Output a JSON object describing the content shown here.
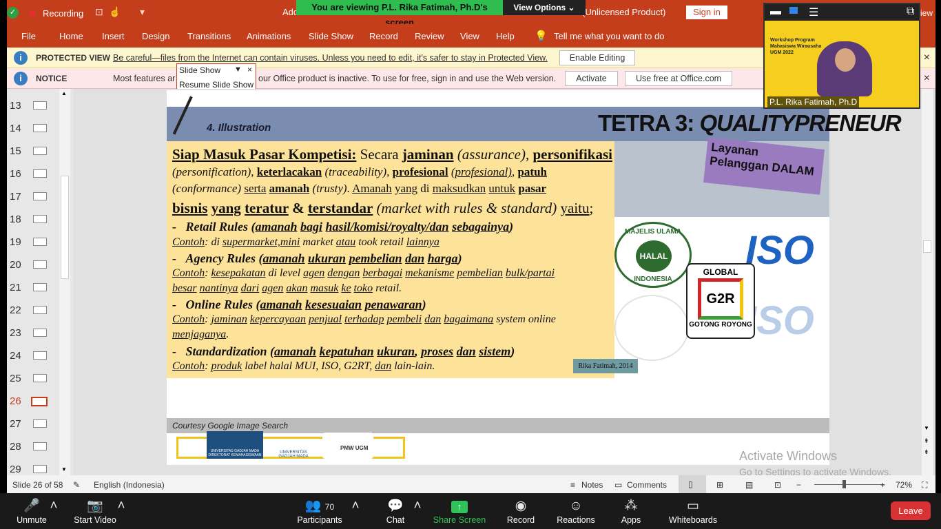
{
  "window": {
    "recording_label": "Recording",
    "doc_title_left": "Add",
    "doc_title_right": "(Unlicensed Product)",
    "viewing_banner": "You are viewing P.L. Rika Fatimah, Ph.D's screen",
    "view_options": "View Options ⌄",
    "sign_in": "Sign in"
  },
  "menu": [
    "File",
    "Home",
    "Insert",
    "Design",
    "Transitions",
    "Animations",
    "Slide Show",
    "Record",
    "Review",
    "View",
    "Help"
  ],
  "tell_me": "Tell me what you want to do",
  "protected_view": {
    "label": "PROTECTED VIEW",
    "message": "Be careful—files from the Internet can contain viruses. Unless you need to edit, it's safer to stay in Protected View.",
    "button": "Enable Editing"
  },
  "notice": {
    "label": "NOTICE",
    "message_left": "Most features ar",
    "message_right": "our Office product is inactive. To use for free, sign in and use the Web version.",
    "activate": "Activate",
    "use_free": "Use free at Office.com"
  },
  "slideshow_menu": {
    "title": "Slide Show",
    "close": "×",
    "resume": "Resume Slide Show"
  },
  "thumbnails": [
    "13",
    "14",
    "15",
    "16",
    "17",
    "18",
    "19",
    "20",
    "21",
    "22",
    "23",
    "24",
    "25",
    "26",
    "27",
    "28",
    "29"
  ],
  "selected_slide": "26",
  "slide": {
    "subtitle": "4. Illustration",
    "title_main": "TETRA 3: ",
    "title_italic": "QUALITYPRENEUR",
    "para_lines": [
      "<u><b>Siap Masuk Pasar Kompetisi:</b></u> Secara <b><u>jaminan</u></b> <i>(assurance)</i>, <b><u>personifikasi</u></b>",
      "<i>(personification)</i>, <b><u>keterlacakan</u></b> <i>(traceability)</i>, <b><u>profesional</u></b> <i><u>(profesional)</u></i>, <b><u>patuh</u></b>",
      "<i>(conformance)</i> <u>serta</u> <b><u>amanah</u></b> <i>(trusty)</i>. <u>Amanah</u> <u>yang</u> di <u>maksudkan</u> <u>untuk</u> <b><u>pasar</u></b>",
      "<b><u>bisnis</u> <u>yang</u> <u>teratur</u> &amp; <u>terstandar</u></b> <i>(market with rules &amp; standard)</i> <u>yaitu</u>;"
    ],
    "bullets": [
      {
        "head": "-&nbsp;&nbsp;&nbsp;Retail Rules (<u>amanah</u> <u>bagi</u> <u>hasil/komisi/royalty/dan</u> <u>sebagainya</u>)",
        "sub": [
          "<u>Contoh</u>: di <u>supermarket,mini</u> market <u>atau</u> took retail <u>lainnya</u>"
        ]
      },
      {
        "head": "-&nbsp;&nbsp;&nbsp;Agency Rules (<u>amanah</u> <u>ukuran</u> <u>pembelian</u> <u>dan</u> <u>harga</u>)",
        "sub": [
          "<u>Contoh</u>: <u>kesepakatan</u> di level <u>agen</u> <u>dengan</u> <u>berbagai</u> <u>mekanisme</u> <u>pembelian</u> <u>bulk/partai</u>",
          "<u>besar</u> <u>nantinya</u> <u>dari</u> <u>agen</u> <u>akan</u> <u>masuk</u> <u>ke</u> <u>toko</u> retail."
        ]
      },
      {
        "head": "-&nbsp;&nbsp;&nbsp;Online Rules (<u>amanah</u> <u>kesesuaian</u> <u>penawaran</u>)",
        "sub": [
          "<u>Contoh</u>: <u>jaminan</u> <u>kepercayaan</u> <u>penjual</u> <u>terhadap</u> <u>pembeli</u> <u>dan</u> <u>bagaimana</u> system online",
          "<u>menjaganya</u>."
        ]
      },
      {
        "head": "-&nbsp;&nbsp;&nbsp;Standardization (<u>amanah</u> <u>kepatuhan</u> <u>ukuran</u>, <u>proses</u> <u>dan</u> <u>sistem</u>)",
        "sub": [
          "<u>Contoh</u>: <u>produk</u> label halal MUI, ISO, G2RT, <u>dan</u> lain-lain."
        ]
      }
    ],
    "layanan": "Layanan Pelanggan DALAM",
    "halal_top": "MAJELIS ULAMA",
    "halal_center": "HALAL",
    "halal_bottom": "INDONESIA",
    "iso": "ISO",
    "g2r_top": "GLOBAL",
    "g2r_mid": "G2R",
    "g2r_bottom": "GOTONG ROYONG",
    "credit": "Rika Fatimah, 2014",
    "courtesy": "Courtesy Google Image Search",
    "logo1": "UNIVERSITAS GADJAH MADA DIREKTORAT KEMAHASISWAAN",
    "logo2": "UNIVERSITAS GADJAH MADA",
    "logo3": "PMW UGM"
  },
  "activate_windows": {
    "title": "Activate Windows",
    "sub": "Go to Settings to activate Windows."
  },
  "status_bar": {
    "slide_of": "Slide 26 of 58",
    "language": "English (Indonesia)",
    "notes": "Notes",
    "comments": "Comments",
    "zoom_pct": "72%",
    "zoom_level": 0.72
  },
  "zoom_toolbar": {
    "unmute": "Unmute",
    "start_video": "Start Video",
    "participants": "Participants",
    "participant_count": "70",
    "chat": "Chat",
    "share_screen": "Share Screen",
    "record": "Record",
    "reactions": "Reactions",
    "apps": "Apps",
    "whiteboards": "Whiteboards",
    "leave": "Leave"
  },
  "video": {
    "name": "P.L. Rika Fatimah, Ph.D",
    "slide_text": "Workshop Program Mahasiswa Wirausaha UGM 2022",
    "right_edge_text": "iew"
  },
  "colors": {
    "ribbon": "#c43e1c",
    "share_green": "#2fc35a",
    "leave_red": "#d93234"
  }
}
